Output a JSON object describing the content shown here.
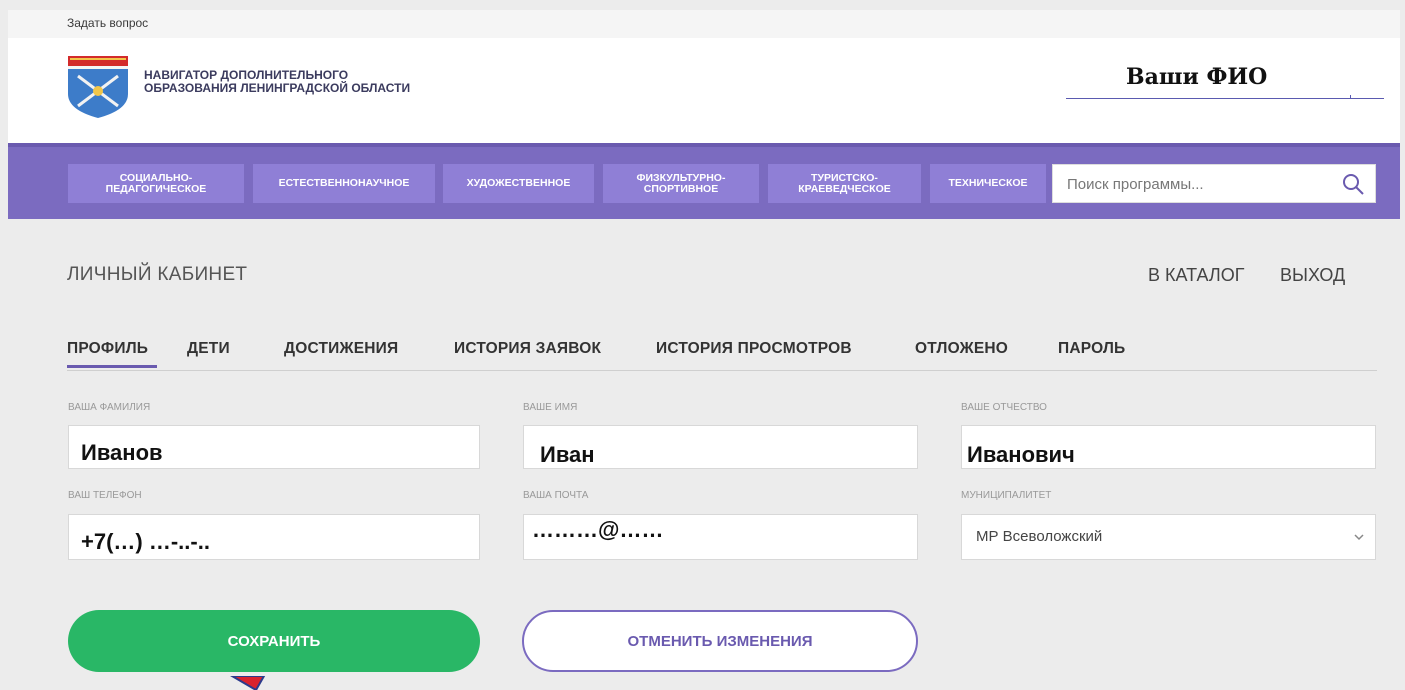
{
  "topbar": {
    "ask_question": "Задать вопрос"
  },
  "header": {
    "logo_text": "НАВИГАТОР ДОПОЛНИТЕЛЬНОГО ОБРАЗОВАНИЯ ЛЕНИНГРАДСКОЙ ОБЛАСТИ",
    "user_name": "Ваши ФИО"
  },
  "nav": {
    "items": [
      {
        "label": "СОЦИАЛЬНО-ПЕДАГОГИЧЕСКОЕ"
      },
      {
        "label": "ЕСТЕСТВЕННОНАУЧНОЕ"
      },
      {
        "label": "ХУДОЖЕСТВЕННОЕ"
      },
      {
        "label": "ФИЗКУЛЬТУРНО-СПОРТИВНОЕ"
      },
      {
        "label": "ТУРИСТСКО-КРАЕВЕДЧЕСКОЕ"
      },
      {
        "label": "ТЕХНИЧЕСКОЕ"
      }
    ],
    "search_placeholder": "Поиск программы...",
    "search_icon": "search-icon"
  },
  "page": {
    "title": "ЛИЧНЫЙ КАБИНЕТ",
    "catalog_link": "В КАТАЛОГ",
    "logout_link": "ВЫХОД"
  },
  "tabs": [
    {
      "label": "ПРОФИЛЬ",
      "active": true
    },
    {
      "label": "ДЕТИ"
    },
    {
      "label": "ДОСТИЖЕНИЯ"
    },
    {
      "label": "ИСТОРИЯ ЗАЯВОК"
    },
    {
      "label": "ИСТОРИЯ ПРОСМОТРОВ"
    },
    {
      "label": "ОТЛОЖЕНО"
    },
    {
      "label": "ПАРОЛЬ"
    }
  ],
  "form": {
    "surname": {
      "label": "ВАША ФАМИЛИЯ",
      "value": "Иванов"
    },
    "name": {
      "label": "ВАШЕ ИМЯ",
      "value": "Иван"
    },
    "patronymic": {
      "label": "ВАШЕ ОТЧЕСТВО",
      "value": "Иванович"
    },
    "phone": {
      "label": "ВАШ ТЕЛЕФОН",
      "value": "+7(…) …-..-.."
    },
    "email": {
      "label": "ВАША ПОЧТА",
      "value": "………@……"
    },
    "municipality": {
      "label": "МУНИЦИПАЛИТЕТ",
      "value": "МР Всеволожский"
    }
  },
  "buttons": {
    "save": "СОХРАНИТЬ",
    "cancel": "ОТМЕНИТЬ ИЗМЕНЕНИЯ"
  },
  "colors": {
    "nav_bg": "#7b6bc0",
    "nav_btn": "#8f7fd6",
    "save_green": "#29b766",
    "accent_purple": "#6a5aaf"
  }
}
